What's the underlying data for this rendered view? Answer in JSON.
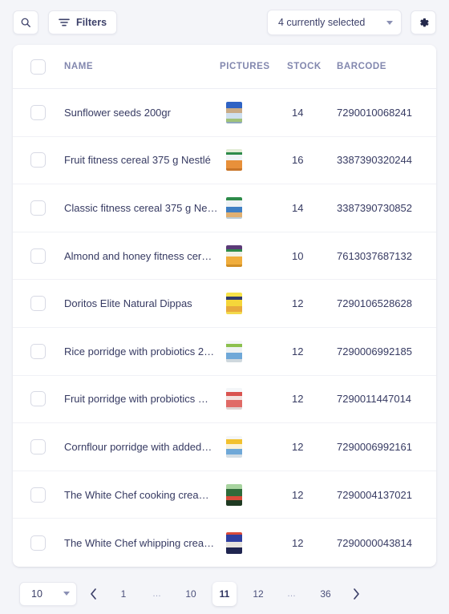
{
  "toolbar": {
    "search_icon": "search-icon",
    "filters_label": "Filters",
    "filters_icon": "filter-icon",
    "selection_label": "4 currently selected",
    "settings_icon": "gear-icon",
    "dropdown_icon": "chevron-down-icon"
  },
  "table": {
    "columns": [
      "NAME",
      "PICTURES",
      "STOCK",
      "BARCODE"
    ],
    "rows": [
      {
        "name": "Sunflower seeds 200gr",
        "stock": "14",
        "barcode": "7290010068241",
        "picture": "product-thumbnail-sunflower-seeds"
      },
      {
        "name": "Fruit fitness cereal 375 g Nestlé",
        "stock": "16",
        "barcode": "3387390320244",
        "picture": "product-thumbnail-fruit-fitness-cereal"
      },
      {
        "name": "Classic fitness cereal 375 g Ne…",
        "stock": "14",
        "barcode": "3387390730852",
        "picture": "product-thumbnail-classic-fitness-cereal"
      },
      {
        "name": "Almond and honey fitness cer…",
        "stock": "10",
        "barcode": "7613037687132",
        "picture": "product-thumbnail-almond-honey-cereal"
      },
      {
        "name": "Doritos Elite Natural Dippas",
        "stock": "12",
        "barcode": "7290106528628",
        "picture": "product-thumbnail-doritos-dippas"
      },
      {
        "name": "Rice porridge with probiotics 2…",
        "stock": "12",
        "barcode": "7290006992185",
        "picture": "product-thumbnail-rice-porridge"
      },
      {
        "name": "Fruit porridge with probiotics …",
        "stock": "12",
        "barcode": "7290011447014",
        "picture": "product-thumbnail-fruit-porridge"
      },
      {
        "name": "Cornflour porridge with added…",
        "stock": "12",
        "barcode": "7290006992161",
        "picture": "product-thumbnail-cornflour-porridge"
      },
      {
        "name": "The White Chef cooking crea…",
        "stock": "12",
        "barcode": "7290004137021",
        "picture": "product-thumbnail-cooking-cream"
      },
      {
        "name": "The White Chef whipping crea…",
        "stock": "12",
        "barcode": "7290000043814",
        "picture": "product-thumbnail-whipping-cream"
      }
    ]
  },
  "footer": {
    "page_size": "10",
    "page_size_icon": "chevron-down-icon",
    "prev_icon": "chevron-left-icon",
    "next_icon": "chevron-right-icon",
    "pages": [
      "1",
      "…",
      "10",
      "11",
      "12",
      "…",
      "36"
    ],
    "current_page": "11"
  },
  "colors": {
    "background": "#f4f5f9",
    "card": "#ffffff",
    "text": "#363a62",
    "header_text": "#8287ae",
    "border": "#eceef4"
  }
}
